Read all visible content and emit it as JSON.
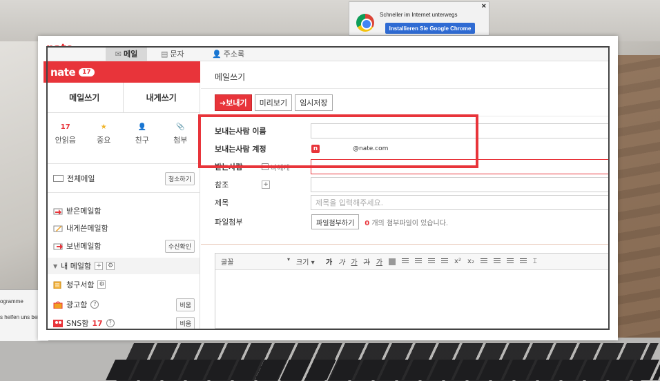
{
  "chrome_ad": {
    "text": "Schneller im Internet unterwegs",
    "button": "Installieren Sie Google Chrome",
    "close": "×"
  },
  "background": {
    "left_window_line1": "ogramme",
    "left_window_line2": "s helfen uns bei"
  },
  "topnav": {
    "logo": "nate",
    "tabs": [
      {
        "label": "메일",
        "icon": "✉"
      },
      {
        "label": "문자",
        "icon": "▤"
      },
      {
        "label": "주소록",
        "icon": "👤"
      }
    ]
  },
  "sidebar": {
    "logo": "nate",
    "badge": "17",
    "write_mail": "메일쓰기",
    "write_self": "내게쓰기",
    "stats": [
      {
        "top": "17",
        "label": "안읽음"
      },
      {
        "top": "★",
        "label": "중요"
      },
      {
        "top": "👤",
        "label": "친구"
      },
      {
        "top": "📎",
        "label": "첨부"
      }
    ],
    "all_mail": "전체메일",
    "clean_btn": "청소하기",
    "folders": [
      {
        "label": "받은메일함"
      },
      {
        "label": "내게쓴메일함"
      },
      {
        "label": "보낸메일함",
        "action": "수신확인"
      }
    ],
    "my_folders": "내 메일함",
    "bill": "청구서함",
    "ad": "광고함",
    "ad_btn": "비움",
    "sns": "SNS함",
    "sns_count": "17",
    "sns_btn": "비움",
    "plus": "+",
    "gear": "⚙",
    "help": "?"
  },
  "compose": {
    "title": "메일쓰기",
    "send": "➜보내기",
    "preview": "미리보기",
    "save": "임시저장",
    "sender_name_label": "보내는사람 이름",
    "sender_account_label": "보내는사람 계정",
    "sender_account_badge": "n",
    "sender_account_domain": "@nate.com",
    "recipient_label": "받는사람",
    "recipient_check": "나에게",
    "cc_label": "참조",
    "subject_label": "제목",
    "subject_placeholder": "제목을 입력해주세요.",
    "attach_label": "파일첨부",
    "attach_btn": "파일첨부하기",
    "attach_count": "0",
    "attach_note": "개의 첨부파일이 있습니다."
  },
  "editor": {
    "font": "굴꼴",
    "size": "크기",
    "tools": [
      "가",
      "가",
      "가",
      "가",
      "가"
    ]
  },
  "colors": {
    "brand_red": "#e8343a"
  }
}
